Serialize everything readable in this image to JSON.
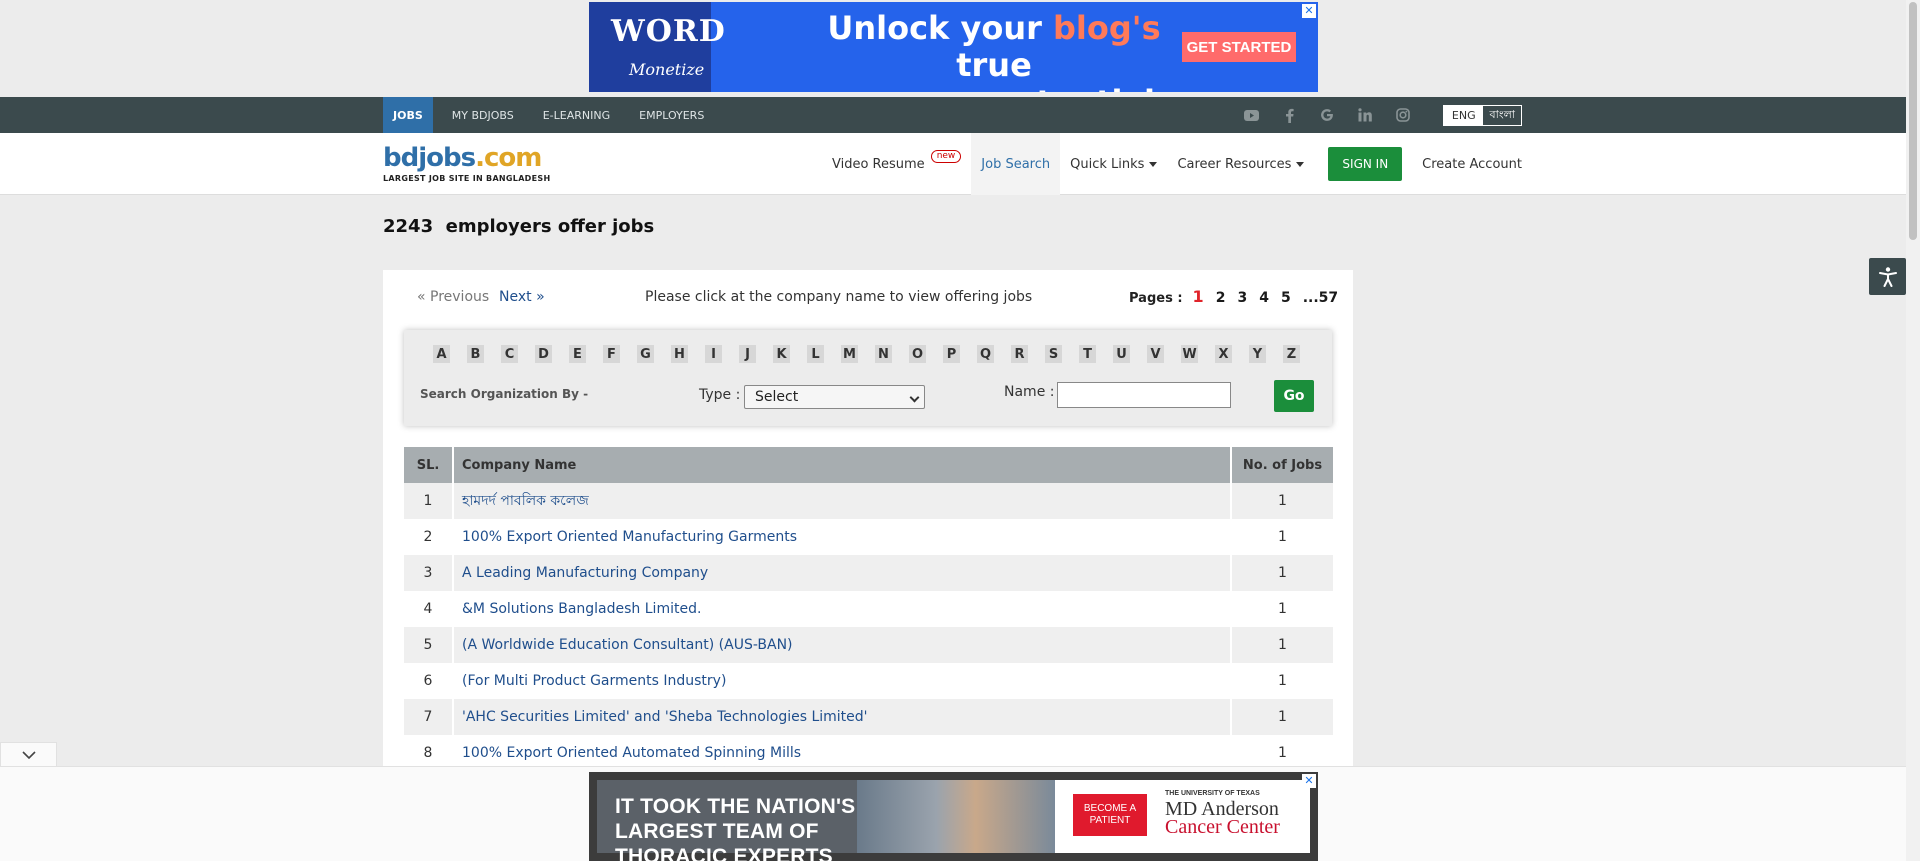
{
  "top_ad": {
    "logo_word": "WORD",
    "logo_sub": "Monetize",
    "headline_line1_pre": "Unlock your ",
    "headline_line1_accent": "blog's",
    "headline_line1_post": " true",
    "headline_line2_accent": "revenue",
    "headline_line2_post": " potential",
    "cta": "GET STARTED",
    "close": "✕"
  },
  "topbar": {
    "tabs": [
      {
        "label": "JOBS",
        "active": true
      },
      {
        "label": "MY BDJOBS"
      },
      {
        "label": "E-LEARNING"
      },
      {
        "label": "EMPLOYERS"
      }
    ],
    "social_icons": [
      "youtube-icon",
      "facebook-icon",
      "google-icon",
      "linkedin-icon",
      "instagram-icon"
    ],
    "lang_eng": "ENG",
    "lang_bangla": "বাংলা"
  },
  "brand": {
    "name_part1": "bdjobs",
    "name_part2": ".com",
    "tagline": "LARGEST JOB SITE IN BANGLADESH"
  },
  "nav": {
    "video_resume": "Video Resume",
    "new_badge": "new",
    "job_search": "Job Search",
    "quick_links": "Quick Links",
    "career_resources": "Career Resources",
    "sign_in": "SIGN IN",
    "create_account": "Create Account"
  },
  "heading": {
    "count": "2243",
    "text": "employers offer jobs"
  },
  "pager": {
    "prev": "« Previous",
    "next": "Next »",
    "hint": "Please click at the company name to view offering jobs",
    "pages_label": "Pages :",
    "pages": [
      "1",
      "2",
      "3",
      "4",
      "5",
      "...57"
    ],
    "current_page": "1"
  },
  "filter": {
    "letters": [
      "A",
      "B",
      "C",
      "D",
      "E",
      "F",
      "G",
      "H",
      "I",
      "J",
      "K",
      "L",
      "M",
      "N",
      "O",
      "P",
      "Q",
      "R",
      "S",
      "T",
      "U",
      "V",
      "W",
      "X",
      "Y",
      "Z"
    ],
    "org_label": "Search Organization By -",
    "type_label": "Type :",
    "type_selected": "Select",
    "name_label": "Name :",
    "name_value": "",
    "go": "Go"
  },
  "table": {
    "headers": {
      "sl": "SL.",
      "company": "Company Name",
      "jobs": "No. of Jobs"
    },
    "rows": [
      {
        "sl": "1",
        "company": "হামদর্দ পাবলিক কলেজ",
        "jobs": "1"
      },
      {
        "sl": "2",
        "company": "100% Export Oriented Manufacturing Garments",
        "jobs": "1"
      },
      {
        "sl": "3",
        "company": "A Leading Manufacturing Company",
        "jobs": "1"
      },
      {
        "sl": "4",
        "company": "&M Solutions Bangladesh Limited.",
        "jobs": "1"
      },
      {
        "sl": "5",
        "company": "(A Worldwide Education Consultant) (AUS-BAN)",
        "jobs": "1"
      },
      {
        "sl": "6",
        "company": "(For Multi Product Garments Industry)",
        "jobs": "1"
      },
      {
        "sl": "7",
        "company": "'AHC Securities Limited' and 'Sheba Technologies Limited'",
        "jobs": "1"
      },
      {
        "sl": "8",
        "company": "100% Export Oriented Automated Spinning Mills",
        "jobs": "1"
      }
    ]
  },
  "bottom_ad": {
    "headline": "IT TOOK THE NATION'S LARGEST TEAM OF THORACIC EXPERTS",
    "cta": "BECOME A PATIENT",
    "org_small": "THE UNIVERSITY OF TEXAS",
    "org_name_1": "MD Anderson",
    "org_name_2": "Cancer Center",
    "close": "✕"
  },
  "colors": {
    "topbar": "#3b4a4d",
    "active_tab": "#2f6fa8",
    "link": "#1f4e8c",
    "green_button": "#1b8e3b",
    "current_page": "#e0242a"
  }
}
